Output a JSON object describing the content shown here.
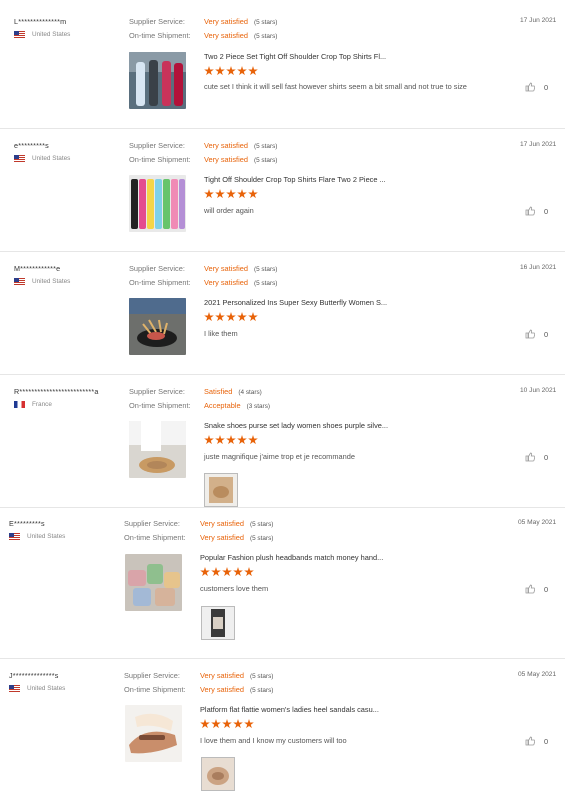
{
  "labels": {
    "supplier": "Supplier Service:",
    "shipment": "On-time Shipment:"
  },
  "icons": {
    "like": "thumbs-up-icon",
    "star": "star-icon"
  },
  "accent_color": "#e8630a",
  "reviews": [
    {
      "user": "L**************m",
      "country": "United States",
      "flag": "us",
      "supplier_value": "Very satisfied",
      "supplier_stars": "(5 stars)",
      "shipment_value": "Very satisfied",
      "shipment_stars": "(5 stars)",
      "date": "17 Jun 2021",
      "title": "Two 2 Piece Set Tight Off Shoulder Crop Top Shirts Fl...",
      "rating": 5,
      "comment": "cute set I think it will sell fast however shirts seem a bit small and not true to size",
      "likes": "0",
      "has_photo": false
    },
    {
      "user": "e*********s",
      "country": "United States",
      "flag": "us",
      "supplier_value": "Very satisfied",
      "supplier_stars": "(5 stars)",
      "shipment_value": "Very satisfied",
      "shipment_stars": "(5 stars)",
      "date": "17 Jun 2021",
      "title": "Tight Off Shoulder Crop Top Shirts Flare Two 2 Piece ...",
      "rating": 5,
      "comment": "will order again",
      "likes": "0",
      "has_photo": false
    },
    {
      "user": "M************e",
      "country": "United States",
      "flag": "us",
      "supplier_value": "Very satisfied",
      "supplier_stars": "(5 stars)",
      "shipment_value": "Very satisfied",
      "shipment_stars": "(5 stars)",
      "date": "16 Jun 2021",
      "title": "2021 Personalized Ins Super Sexy Butterfly Women S...",
      "rating": 5,
      "comment": "I like them",
      "likes": "0",
      "has_photo": false
    },
    {
      "user": "R*************************a",
      "country": "France",
      "flag": "fr",
      "supplier_value": "Satisfied",
      "supplier_stars": "(4 stars)",
      "shipment_value": "Acceptable",
      "shipment_stars": "(3 stars)",
      "date": "10 Jun 2021",
      "title": "Snake shoes purse set lady women shoes purple silve...",
      "rating": 5,
      "comment": "juste magnifique j'aime trop et je recommande",
      "likes": "0",
      "has_photo": true
    },
    {
      "user": "E*********s",
      "country": "United States",
      "flag": "us",
      "supplier_value": "Very satisfied",
      "supplier_stars": "(5 stars)",
      "shipment_value": "Very satisfied",
      "shipment_stars": "(5 stars)",
      "date": "05 May 2021",
      "title": "Popular Fashion plush headbands match money hand...",
      "rating": 5,
      "comment": "customers love them",
      "likes": "0",
      "has_photo": true
    },
    {
      "user": "J**************s",
      "country": "United States",
      "flag": "us",
      "supplier_value": "Very satisfied",
      "supplier_stars": "(5 stars)",
      "shipment_value": "Very satisfied",
      "shipment_stars": "(5 stars)",
      "date": "05 May 2021",
      "title": "Platform flat flattie women's ladies heel sandals casu...",
      "rating": 5,
      "comment": "I love them and I know my customers will too",
      "likes": "0",
      "has_photo": true
    }
  ]
}
